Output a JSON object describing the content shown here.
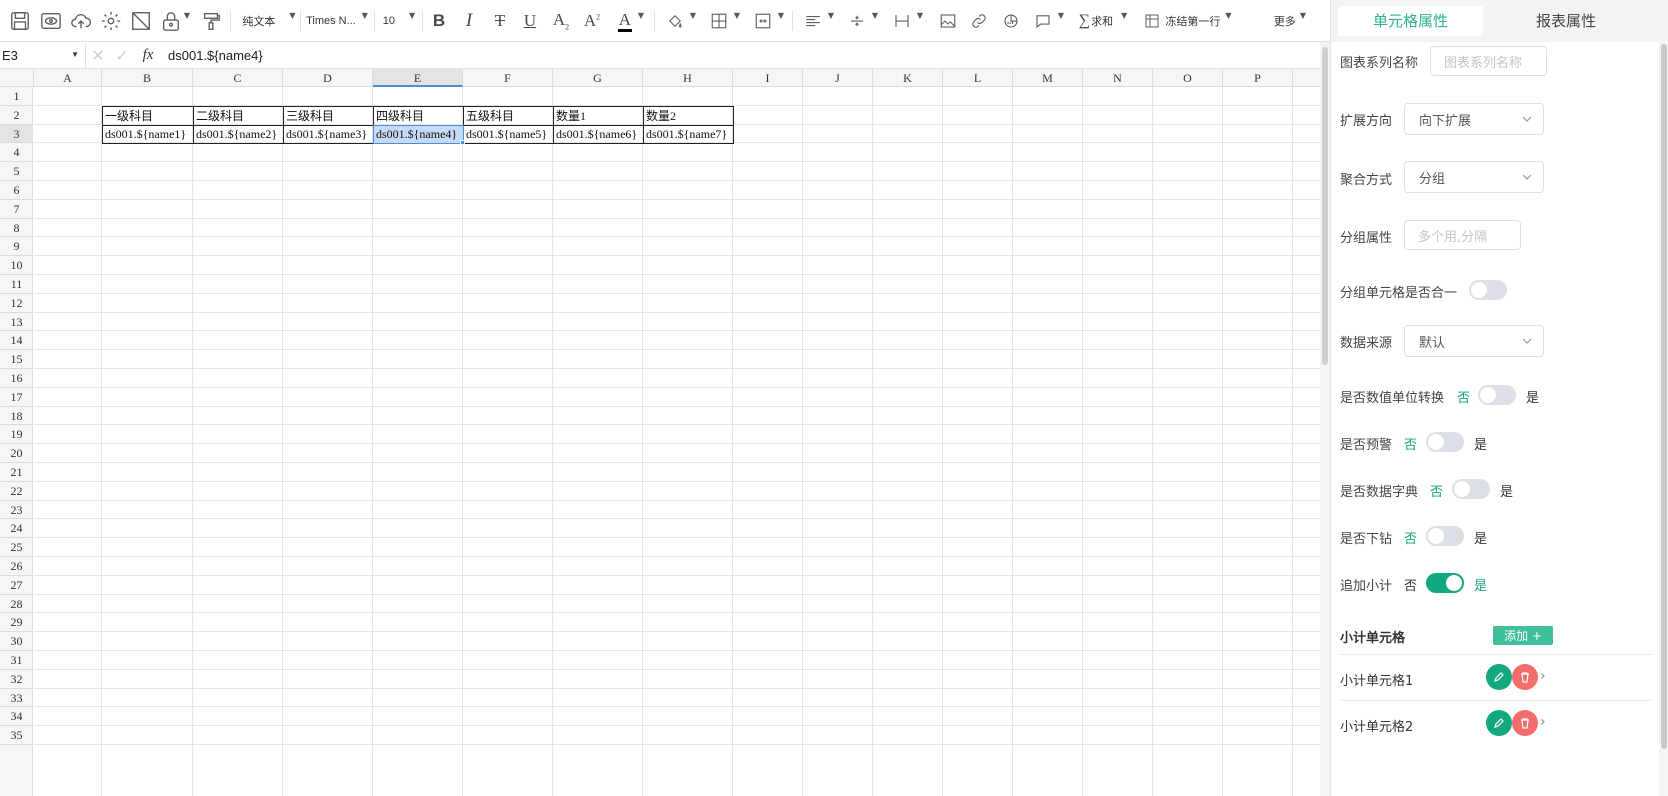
{
  "toolbar": {
    "plain_text": "纯文本",
    "font_name": "Times N...",
    "font_size": "10",
    "sum_label": "求和",
    "freeze_label": "冻结第一行",
    "more_label": "更多"
  },
  "formula_bar": {
    "cell_ref": "E3",
    "fx_label": "fx",
    "value": "ds001.${name4}"
  },
  "sheet": {
    "columns": [
      "A",
      "B",
      "C",
      "D",
      "E",
      "F",
      "G",
      "H",
      "I",
      "J",
      "K",
      "L",
      "M",
      "N",
      "O",
      "P"
    ],
    "selected_column": "E",
    "selected_row": 3,
    "row_count": 35,
    "header_row": [
      "一级科目",
      "二级科目",
      "三级科目",
      "四级科目",
      "五级科目",
      "数量1",
      "数量2"
    ],
    "data_row": [
      "ds001.${name1}",
      "ds001.${name2}",
      "ds001.${name3}",
      "ds001.${name4}",
      "ds001.${name5}",
      "ds001.${name6}",
      "ds001.${name7}"
    ]
  },
  "panel": {
    "tab_cell": "单元格属性",
    "tab_report": "报表属性",
    "series_name_label": "图表系列名称",
    "series_name_placeholder": "图表系列名称",
    "expand_label": "扩展方向",
    "expand_value": "向下扩展",
    "aggregate_label": "聚合方式",
    "aggregate_value": "分组",
    "group_attr_label": "分组属性",
    "group_attr_placeholder": "多个用,分隔",
    "merge_label": "分组单元格是否合一",
    "source_label": "数据来源",
    "source_value": "默认",
    "unit_label": "是否数值单位转换",
    "warn_label": "是否预警",
    "dict_label": "是否数据字典",
    "drill_label": "是否下钻",
    "subtotal_label": "追加小计",
    "no": "否",
    "yes": "是",
    "subtotal_title": "小计单元格",
    "add_label": "添加 +",
    "subtotals": [
      "小计单元格1",
      "小计单元格2"
    ]
  }
}
